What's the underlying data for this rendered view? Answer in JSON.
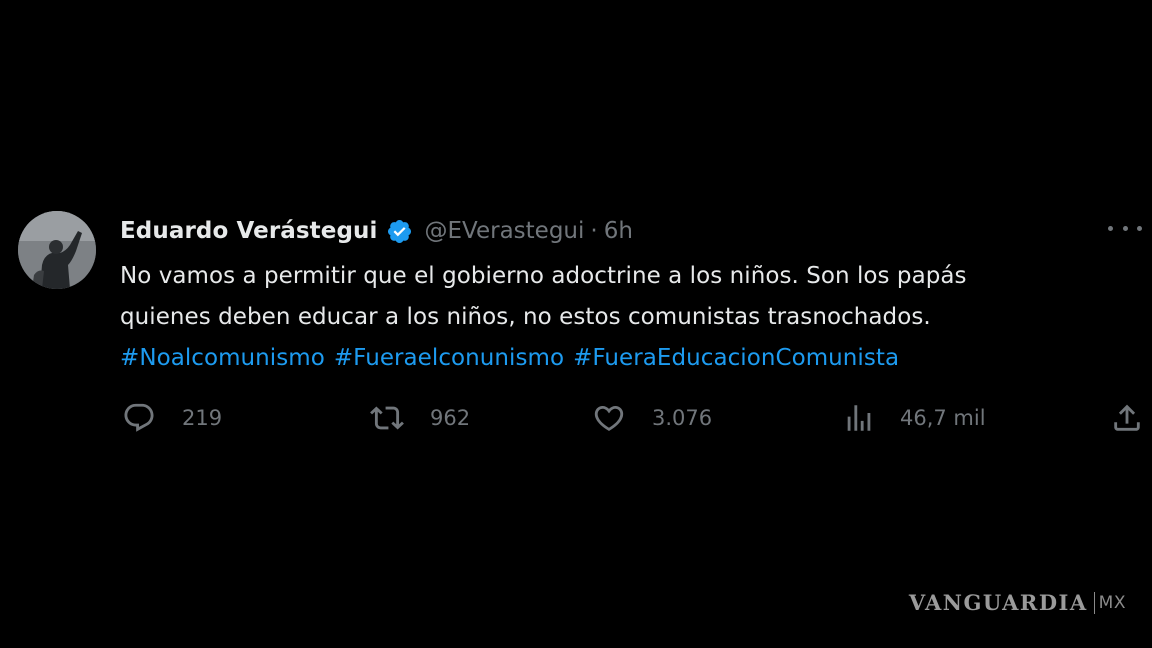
{
  "tweet": {
    "author_name": "Eduardo Verástegui",
    "handle": "@EVerastegui",
    "separator": "·",
    "time": "6h",
    "text_lines": [
      "No vamos a permitir que el gobierno adoctrine a los niños. Son los papás",
      "quienes deben educar a los niños, no estos comunistas trasnochados."
    ],
    "hashtags": [
      "#Noalcomunismo",
      "#Fueraelconunismo",
      "#FueraEducacionComunista"
    ],
    "stats": {
      "replies": "219",
      "retweets": "962",
      "likes": "3.076",
      "views": "46,7 mil"
    },
    "icons": {
      "avatar": "profile-photo",
      "verified": "verified-badge-icon",
      "more": "more-options-icon",
      "reply": "reply-icon",
      "retweet": "retweet-icon",
      "like": "like-icon",
      "views": "views-icon",
      "share": "share-icon"
    }
  },
  "watermark": {
    "brand": "VANGUARDIA",
    "suffix": "MX"
  },
  "colors": {
    "background": "#000000",
    "primary_text": "#e7e9ea",
    "secondary_text": "#71767b",
    "link": "#1d9bf0",
    "verified": "#1d9bf0"
  }
}
